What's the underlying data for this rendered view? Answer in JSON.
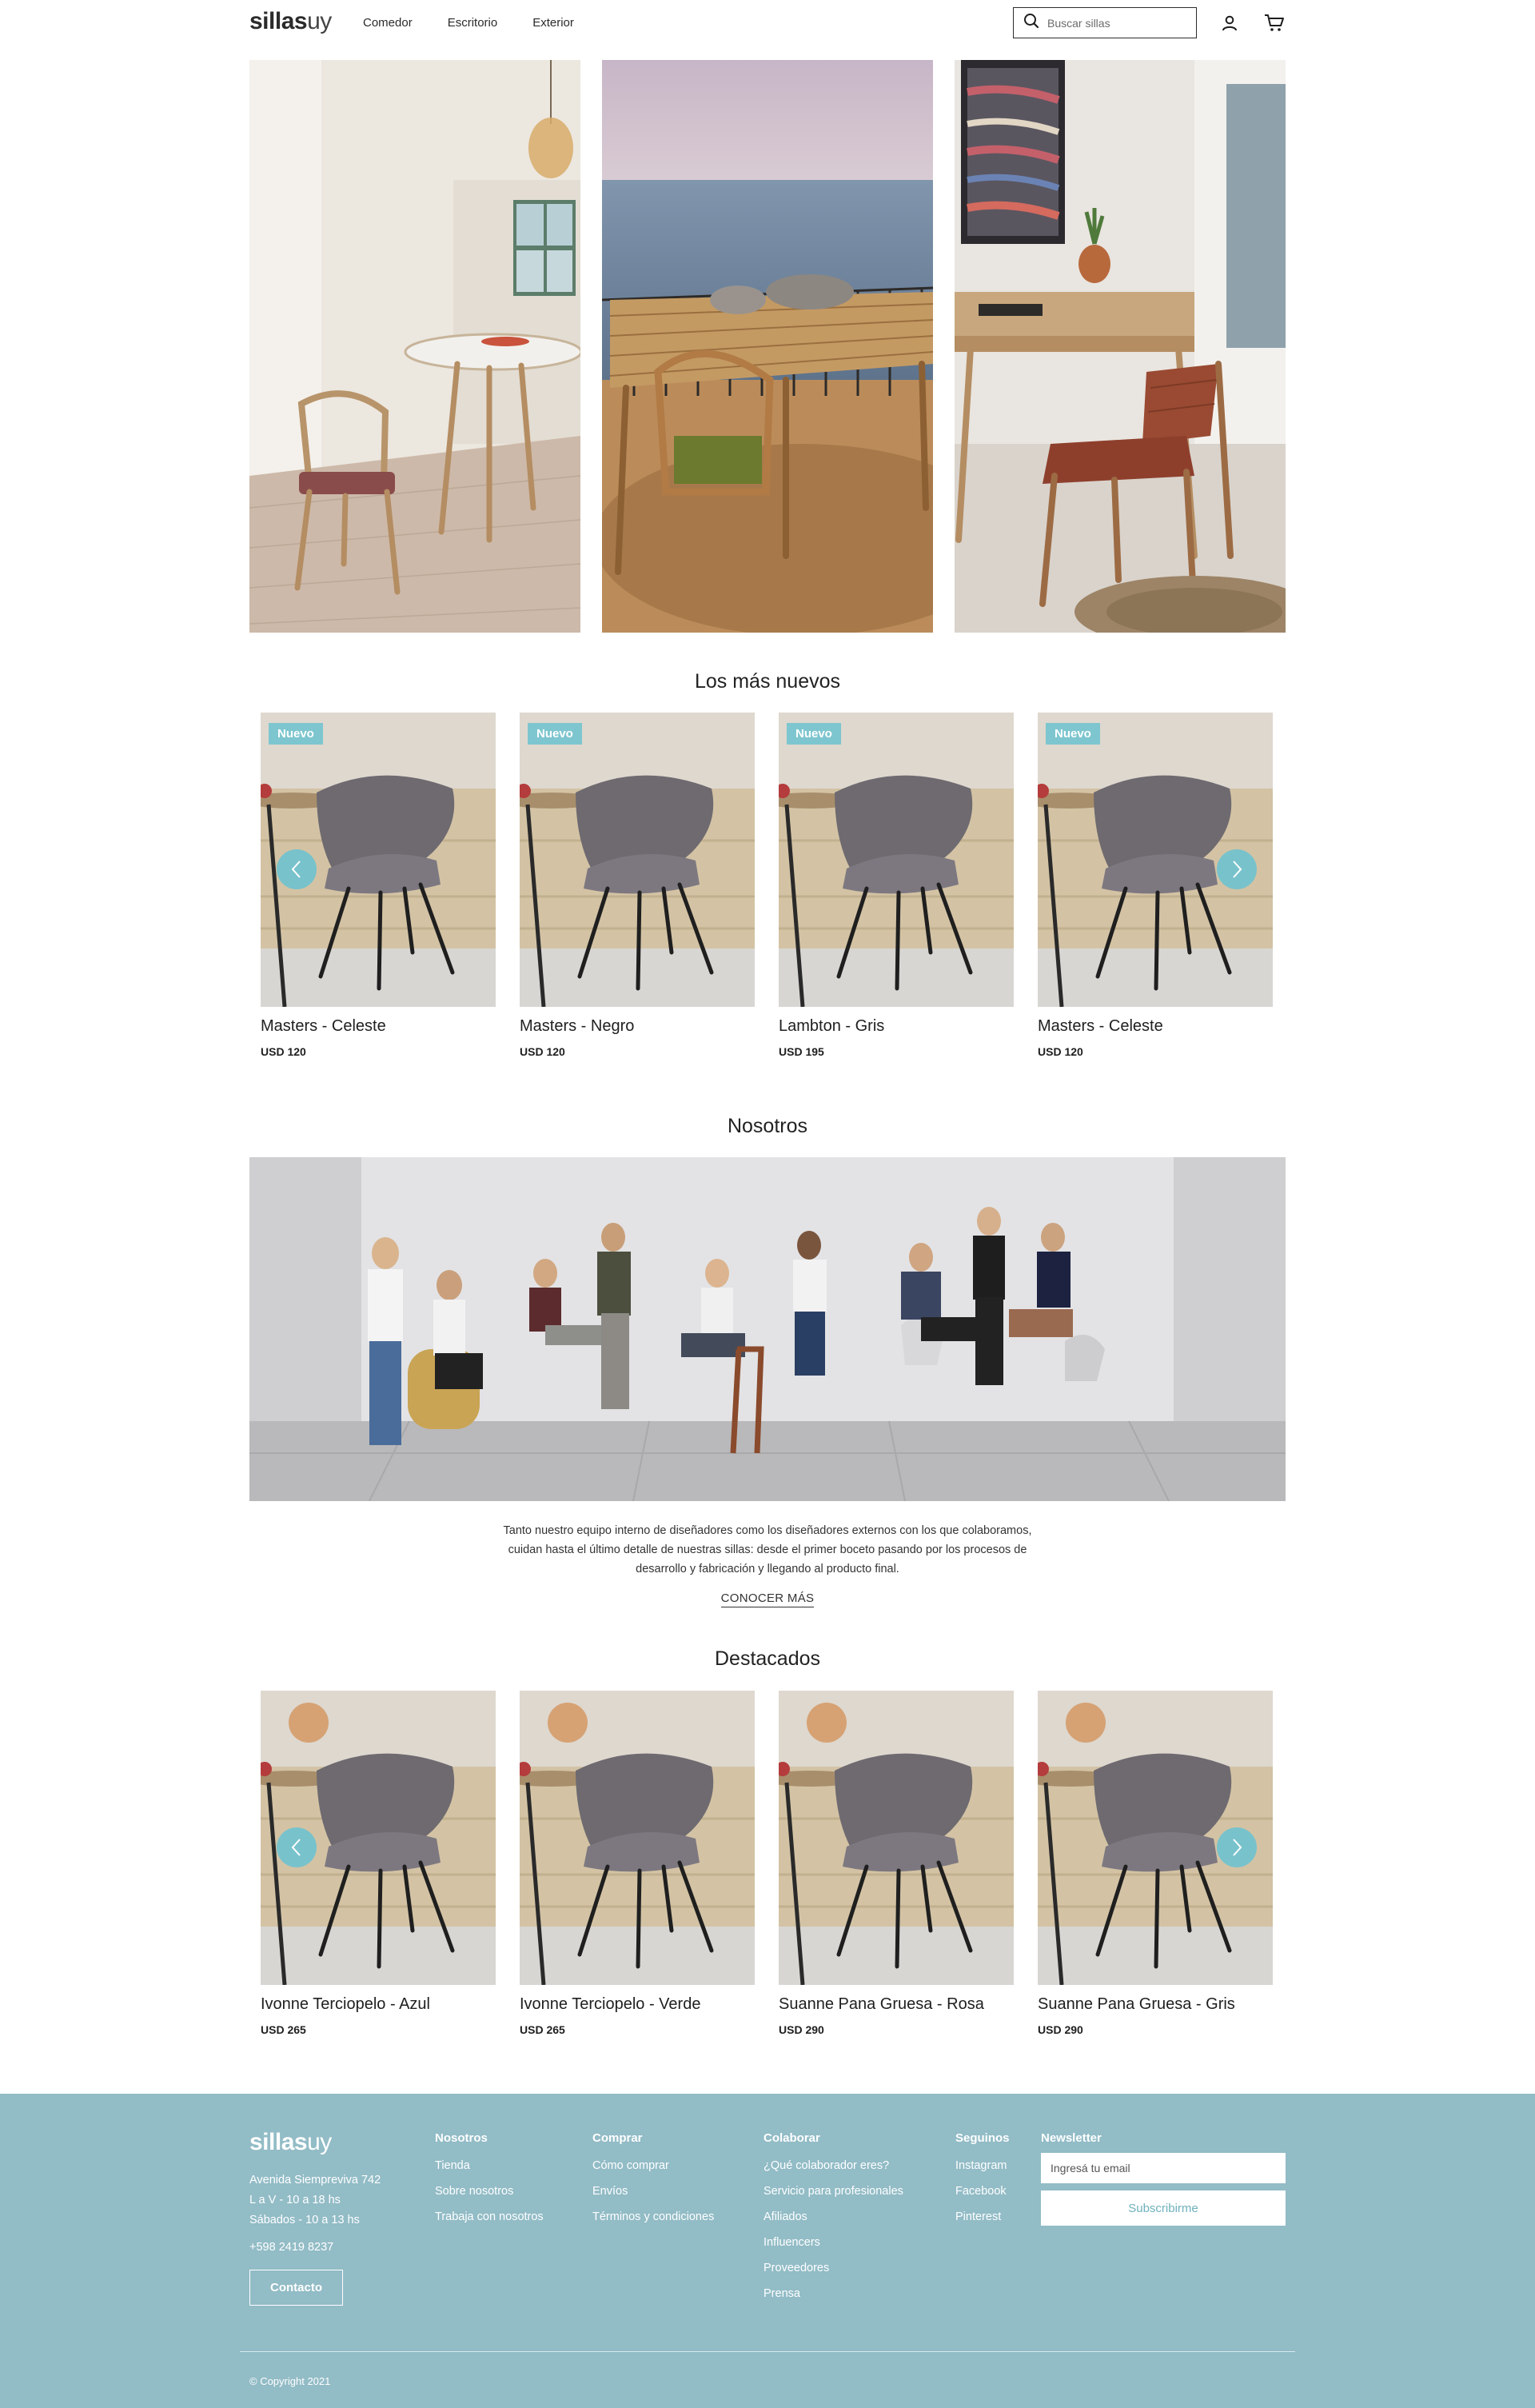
{
  "header": {
    "logo_bold": "sillas",
    "logo_light": "uy",
    "nav": [
      "Comedor",
      "Escritorio",
      "Exterior"
    ],
    "search_placeholder": "Buscar sillas",
    "icons": [
      "search-icon",
      "user-icon",
      "cart-icon"
    ]
  },
  "sections": {
    "newest_title": "Los más nuevos",
    "about_title": "Nosotros",
    "featured_title": "Destacados"
  },
  "newest": [
    {
      "badge": "Nuevo",
      "name": "Masters - Celeste",
      "price": "USD 120"
    },
    {
      "badge": "Nuevo",
      "name": "Masters - Negro",
      "price": "USD 120"
    },
    {
      "badge": "Nuevo",
      "name": "Lambton - Gris",
      "price": "USD 195"
    },
    {
      "badge": "Nuevo",
      "name": "Masters - Celeste",
      "price": "USD 120"
    }
  ],
  "featured": [
    {
      "name": "Ivonne Terciopelo - Azul",
      "price": "USD 265"
    },
    {
      "name": "Ivonne Terciopelo - Verde",
      "price": "USD 265"
    },
    {
      "name": "Suanne Pana Gruesa - Rosa",
      "price": "USD 290"
    },
    {
      "name": "Suanne Pana Gruesa - Gris",
      "price": "USD 290"
    }
  ],
  "about": {
    "text": "Tanto nuestro equipo interno de diseñadores como los diseñadores externos con los que colaboramos, cuidan hasta el último detalle de nuestras sillas: desde el primer boceto pasando por los procesos de desarrollo y fabricación y llegando al producto final.",
    "link": "CONOCER MÁS"
  },
  "footer": {
    "logo_bold": "sillas",
    "logo_light": "uy",
    "address": [
      "Avenida Siempreviva 742",
      "L a V - 10 a 18 hs",
      "Sábados - 10 a 13 hs"
    ],
    "phone": "+598 2419 8237",
    "contact_button": "Contacto",
    "columns": [
      {
        "title": "Nosotros",
        "links": [
          "Tienda",
          "Sobre nosotros",
          "Trabaja con nosotros"
        ]
      },
      {
        "title": "Comprar",
        "links": [
          "Cómo comprar",
          "Envíos",
          "Términos y condiciones"
        ]
      },
      {
        "title": "Colaborar",
        "links": [
          "¿Qué colaborador eres?",
          "Servicio para profesionales",
          "Afiliados",
          "Influencers",
          "Proveedores",
          "Prensa"
        ]
      },
      {
        "title": "Seguinos",
        "links": [
          "Instagram",
          "Facebook",
          "Pinterest"
        ]
      }
    ],
    "newsletter_title": "Newsletter",
    "newsletter_placeholder": "Ingresá tu email",
    "newsletter_button": "Subscribirme",
    "copyright": "© Copyright 2021"
  },
  "colors": {
    "accent": "#7ec6cf",
    "footer_bg": "#92bcc6",
    "text": "#1e1e1e"
  }
}
